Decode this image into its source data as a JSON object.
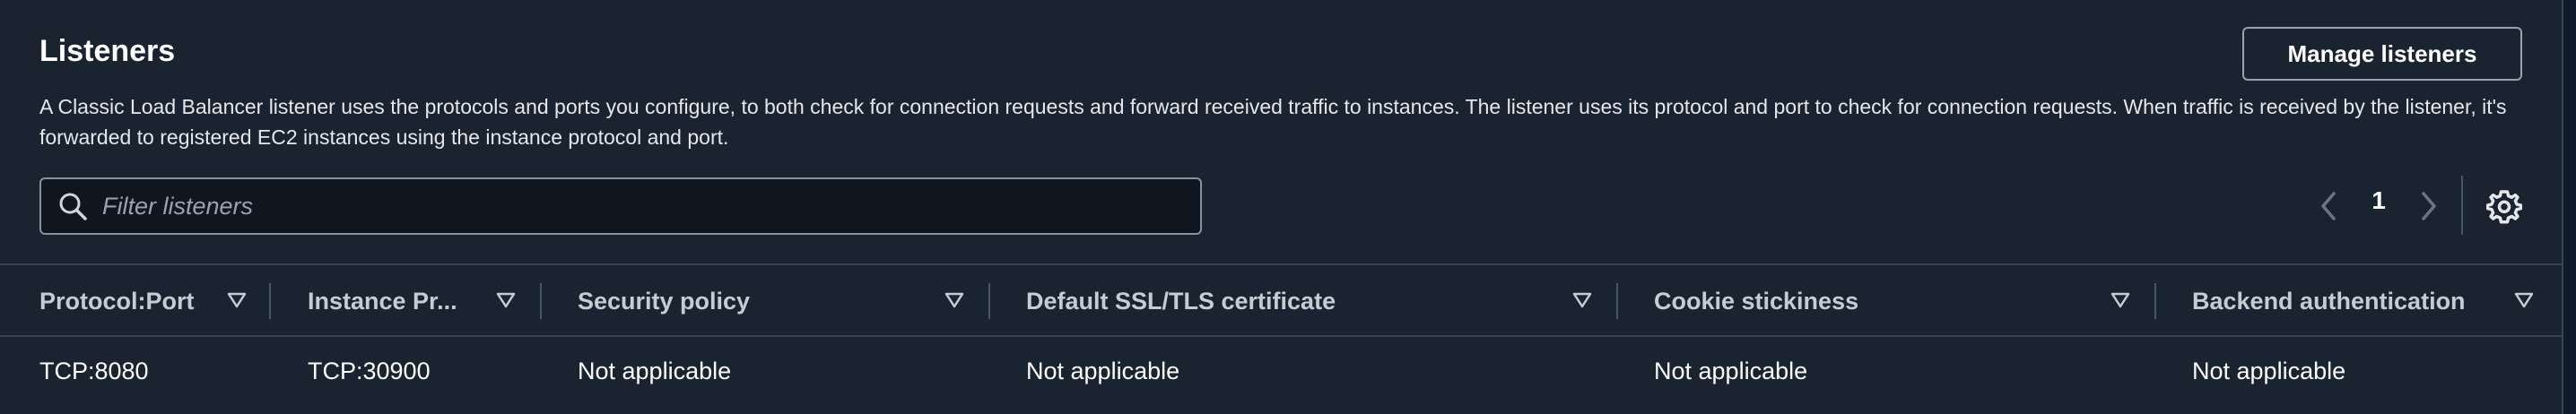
{
  "section": {
    "title": "Listeners",
    "description": "A Classic Load Balancer listener uses the protocols and ports you configure, to both check for connection requests and forward received traffic to instances. The listener uses its protocol and port to check for connection requests. When traffic is received by the listener, it's forwarded to registered EC2 instances using the instance protocol and port.",
    "manage_button": "Manage listeners"
  },
  "filter": {
    "placeholder": "Filter listeners"
  },
  "pagination": {
    "current_page": "1"
  },
  "table": {
    "columns": [
      "Protocol:Port",
      "Instance Pr...",
      "Security policy",
      "Default SSL/TLS certificate",
      "Cookie stickiness",
      "Backend authentication"
    ],
    "rows": [
      [
        "TCP:8080",
        "TCP:30900",
        "Not applicable",
        "Not applicable",
        "Not applicable",
        "Not applicable"
      ]
    ]
  },
  "icons": {
    "search": "search-icon",
    "prev": "chevron-left-icon",
    "next": "chevron-right-icon",
    "settings": "gear-icon",
    "sort": "sort-down-icon"
  },
  "colors": {
    "background": "#1a2330",
    "text": "#ffffff",
    "muted": "#9aa3ad",
    "border": "#3a4450"
  }
}
